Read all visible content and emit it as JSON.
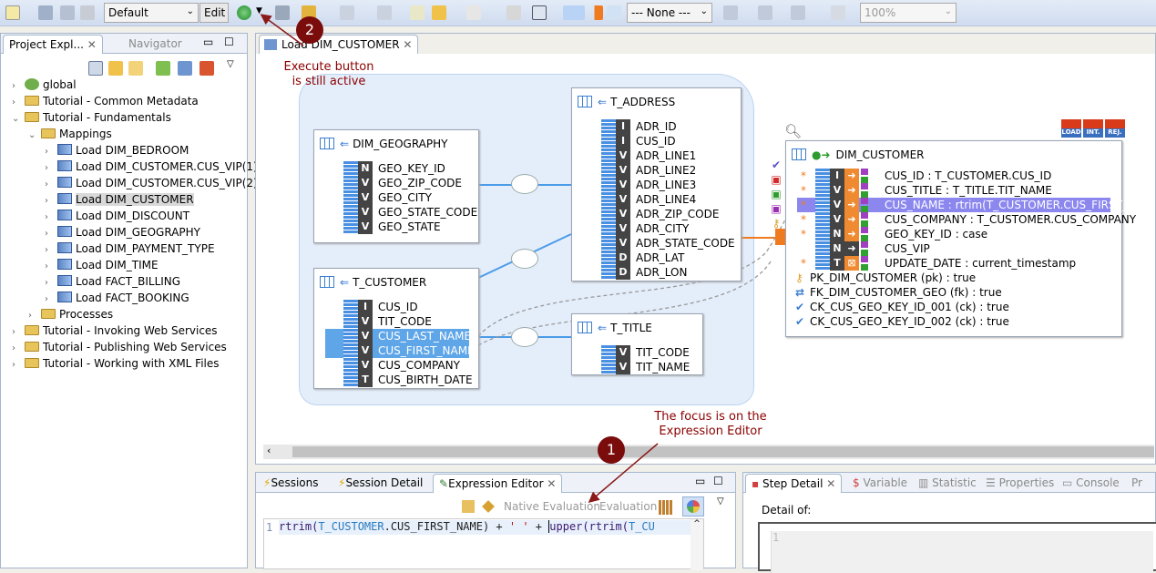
{
  "toolbar": {
    "profile_select": "Default",
    "edit_label": "Edit",
    "none_select": "--- None ---",
    "zoom_select": "100%"
  },
  "explorer": {
    "tabs": [
      {
        "label": "Project Expl..."
      },
      {
        "label": "Navigator"
      }
    ],
    "tree": [
      {
        "label": "global",
        "level": 0,
        "icon": "globe",
        "arrow": ">"
      },
      {
        "label": "Tutorial - Common Metadata",
        "level": 0,
        "icon": "folder",
        "arrow": ">"
      },
      {
        "label": "Tutorial - Fundamentals",
        "level": 0,
        "icon": "folder",
        "arrow": "v"
      },
      {
        "label": "Mappings",
        "level": 1,
        "icon": "folder",
        "arrow": "v"
      },
      {
        "label": "Load DIM_BEDROOM",
        "level": 2,
        "icon": "mapping",
        "arrow": ">"
      },
      {
        "label": "Load DIM_CUSTOMER.CUS_VIP(1)",
        "level": 2,
        "icon": "mapping",
        "arrow": ">"
      },
      {
        "label": "Load DIM_CUSTOMER.CUS_VIP(2)",
        "level": 2,
        "icon": "mapping",
        "arrow": ">"
      },
      {
        "label": "Load DIM_CUSTOMER",
        "level": 2,
        "icon": "mapping",
        "arrow": ">",
        "selected": true
      },
      {
        "label": "Load DIM_DISCOUNT",
        "level": 2,
        "icon": "mapping",
        "arrow": ">"
      },
      {
        "label": "Load DIM_GEOGRAPHY",
        "level": 2,
        "icon": "mapping",
        "arrow": ">"
      },
      {
        "label": "Load DIM_PAYMENT_TYPE",
        "level": 2,
        "icon": "mapping",
        "arrow": ">"
      },
      {
        "label": "Load DIM_TIME",
        "level": 2,
        "icon": "mapping",
        "arrow": ">"
      },
      {
        "label": "Load FACT_BILLING",
        "level": 2,
        "icon": "mapping",
        "arrow": ">"
      },
      {
        "label": "Load FACT_BOOKING",
        "level": 2,
        "icon": "mapping",
        "arrow": ">"
      },
      {
        "label": "Processes",
        "level": 1,
        "icon": "folder",
        "arrow": ">"
      },
      {
        "label": "Tutorial - Invoking Web Services",
        "level": 0,
        "icon": "folder",
        "arrow": ">"
      },
      {
        "label": "Tutorial - Publishing Web Services",
        "level": 0,
        "icon": "folder",
        "arrow": ">"
      },
      {
        "label": "Tutorial - Working with XML Files",
        "level": 0,
        "icon": "folder",
        "arrow": ">"
      }
    ]
  },
  "editor": {
    "tab_label": "Load DIM_CUSTOMER"
  },
  "diagram": {
    "tables": [
      {
        "name": "DIM_GEOGRAPHY",
        "rows": [
          [
            "GEO_KEY_ID",
            "N"
          ],
          [
            "GEO_ZIP_CODE",
            "V"
          ],
          [
            "GEO_CITY",
            "V"
          ],
          [
            "GEO_STATE_CODE",
            "V"
          ],
          [
            "GEO_STATE",
            "V"
          ]
        ]
      },
      {
        "name": "T_CUSTOMER",
        "rows": [
          [
            "CUS_ID",
            "I"
          ],
          [
            "TIT_CODE",
            "V"
          ],
          [
            "CUS_LAST_NAME",
            "V"
          ],
          [
            "CUS_FIRST_NAME",
            "V"
          ],
          [
            "CUS_COMPANY",
            "V"
          ],
          [
            "CUS_BIRTH_DATE",
            "T"
          ]
        ]
      },
      {
        "name": "T_ADDRESS",
        "rows": [
          [
            "ADR_ID",
            "I"
          ],
          [
            "CUS_ID",
            "I"
          ],
          [
            "ADR_LINE1",
            "V"
          ],
          [
            "ADR_LINE2",
            "V"
          ],
          [
            "ADR_LINE3",
            "V"
          ],
          [
            "ADR_LINE4",
            "V"
          ],
          [
            "ADR_ZIP_CODE",
            "V"
          ],
          [
            "ADR_CITY",
            "V"
          ],
          [
            "ADR_STATE_CODE",
            "V"
          ],
          [
            "ADR_LAT",
            "D"
          ],
          [
            "ADR_LON",
            "D"
          ]
        ]
      },
      {
        "name": "T_TITLE",
        "rows": [
          [
            "TIT_CODE",
            "V"
          ],
          [
            "TIT_NAME",
            "V"
          ]
        ]
      }
    ],
    "target": {
      "name": "DIM_CUSTOMER",
      "badges": [
        "LOAD",
        "INT.",
        "REJ."
      ],
      "rows": [
        [
          "CUS_ID : T_CUSTOMER.CUS_ID",
          "I"
        ],
        [
          "CUS_TITLE : T_TITLE.TIT_NAME",
          "V"
        ],
        [
          "CUS_NAME : rtrim(T_CUSTOMER.CUS_FIRST_N...",
          "V"
        ],
        [
          "CUS_COMPANY : T_CUSTOMER.CUS_COMPANY",
          "V"
        ],
        [
          "GEO_KEY_ID : case",
          "N"
        ],
        [
          "CUS_VIP",
          "N"
        ],
        [
          "UPDATE_DATE : current_timestamp",
          "T"
        ]
      ],
      "constraints": [
        "PK_DIM_CUSTOMER (pk)  : true",
        "FK_DIM_CUSTOMER_GEO (fk)  : true",
        "CK_CUS_GEO_KEY_ID_001 (ck)  : true",
        "CK_CUS_GEO_KEY_ID_002  (ck)  : true"
      ]
    }
  },
  "annotations": {
    "a2_number": "2",
    "a2_line1": "Execute button",
    "a2_line2": "is still active",
    "a1_number": "1",
    "a1_line1": "The focus is on the",
    "a1_line2": "Expression Editor",
    "color": "#8b0000"
  },
  "bottom_left": {
    "tabs": [
      {
        "label": "Sessions"
      },
      {
        "label": "Session Detail"
      },
      {
        "label": "Expression Editor"
      }
    ],
    "native_eval": "Native Evaluation",
    "eval": "Evaluation",
    "line_no": "1",
    "code_a": "rtrim(",
    "code_b": "T_CUSTOMER",
    "code_c": ".CUS_FIRST_NAME) + ",
    "code_d": "' '",
    "code_e": " +  ",
    "code_f": "upper(rtrim(",
    "code_g": "T_CU"
  },
  "bottom_right": {
    "tabs": [
      {
        "label": "Step Detail"
      },
      {
        "label": "Variable"
      },
      {
        "label": "Statistic"
      },
      {
        "label": "Properties"
      },
      {
        "label": "Console"
      },
      {
        "label": "Pr"
      }
    ],
    "detail_label": "Detail of:",
    "line_no": "1"
  }
}
